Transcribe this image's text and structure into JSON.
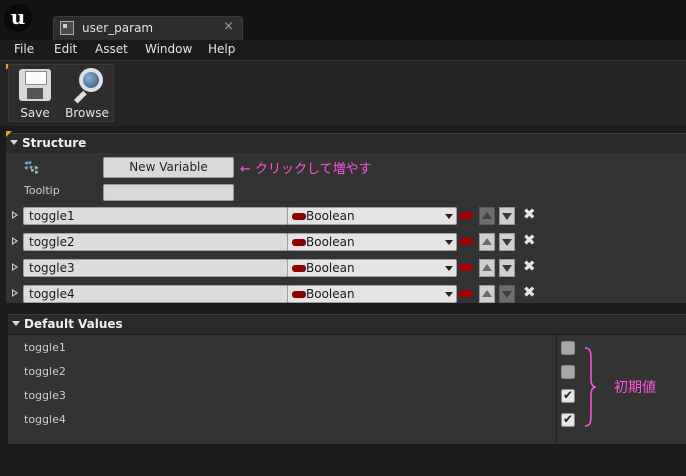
{
  "window": {
    "tab_title": "user_param"
  },
  "menu": [
    "File",
    "Edit",
    "Asset",
    "Window",
    "Help"
  ],
  "toolbar": {
    "save_label": "Save",
    "browse_label": "Browse"
  },
  "structure": {
    "title": "Structure",
    "new_variable_label": "New Variable",
    "annotation": "← クリックして増やす",
    "tooltip_label": "Tooltip",
    "tooltip_value": "",
    "variables": [
      {
        "name": "toggle1",
        "type": "Boolean"
      },
      {
        "name": "toggle2",
        "type": "Boolean"
      },
      {
        "name": "toggle3",
        "type": "Boolean"
      },
      {
        "name": "toggle4",
        "type": "Boolean"
      }
    ]
  },
  "default_values": {
    "title": "Default Values",
    "annotation": "初期値",
    "items": [
      {
        "name": "toggle1",
        "checked": false
      },
      {
        "name": "toggle2",
        "checked": false
      },
      {
        "name": "toggle3",
        "checked": true
      },
      {
        "name": "toggle4",
        "checked": true
      }
    ]
  },
  "colors": {
    "boolean_pin": "#a40000",
    "annotation": "#ff55e0",
    "accent_corner": "#e0a020"
  }
}
